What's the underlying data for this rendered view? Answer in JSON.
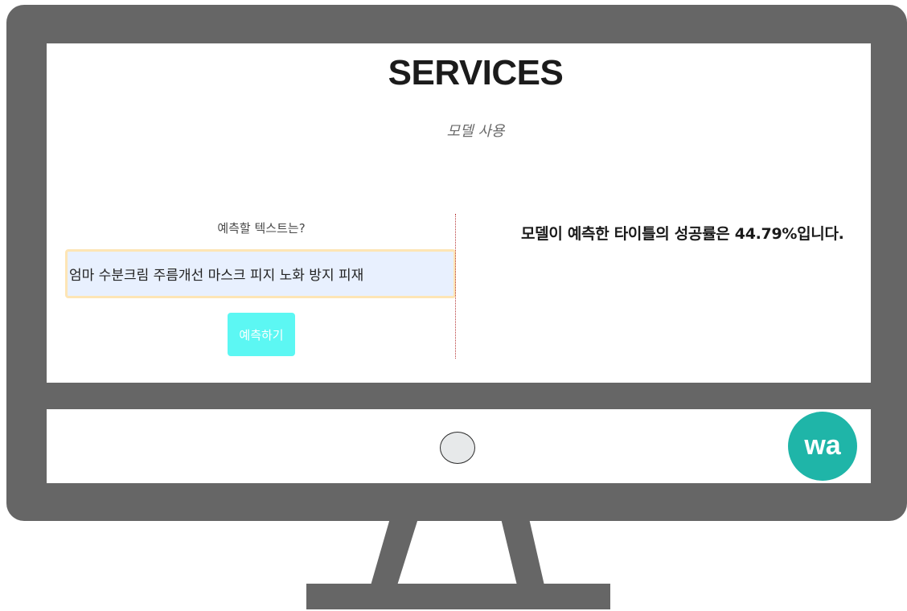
{
  "page": {
    "title": "SERVICES",
    "subtitle": "모델 사용"
  },
  "form": {
    "label": "예측할 텍스트는?",
    "input_value": "엄마 수분크림 주름개선 마스크 피지 노화 방지 피재",
    "submit_label": "예측하기"
  },
  "result": {
    "text": "모델이 예측한 타이틀의 성공률은 44.79%입니다.",
    "success_rate_percent": 44.79
  },
  "logo": {
    "text": "wa",
    "color": "#1fb5a8"
  },
  "colors": {
    "monitor_frame": "#666666",
    "button_bg": "#5cf7f3",
    "input_bg": "#e8f0fe",
    "input_border": "#fde5b5",
    "divider": "#b73b3b"
  }
}
